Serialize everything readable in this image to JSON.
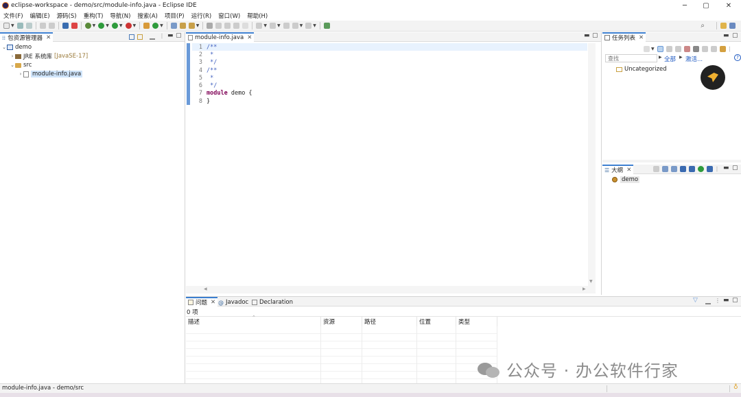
{
  "window": {
    "title": "eclipse-workspace - demo/src/module-info.java - Eclipse IDE",
    "minimize": "─",
    "maximize": "▢",
    "close": "✕"
  },
  "menu": [
    "文件(F)",
    "编辑(E)",
    "源码(S)",
    "重构(T)",
    "导航(N)",
    "搜索(A)",
    "项目(P)",
    "运行(R)",
    "窗口(W)",
    "帮助(H)"
  ],
  "package_explorer": {
    "tab_label": "包资源管理器",
    "tree": [
      {
        "twisty": "⌄",
        "label": "demo",
        "icon": "project-icon"
      },
      {
        "twisty": "›",
        "label": "JRE 系统库",
        "extra": "[JavaSE-17]",
        "icon": "library-icon"
      },
      {
        "twisty": "⌄",
        "label": "src",
        "icon": "package-folder-icon"
      },
      {
        "twisty": "›",
        "label": "module-info.java",
        "icon": "java-file-icon",
        "selected": true
      }
    ]
  },
  "editor": {
    "tab_label": "module-info.java",
    "lines": [
      {
        "n": "1",
        "parts": [
          {
            "c": "cmt",
            "t": "/**"
          }
        ]
      },
      {
        "n": "2",
        "parts": [
          {
            "c": "cmt",
            "t": " *"
          }
        ]
      },
      {
        "n": "3",
        "parts": [
          {
            "c": "cmt",
            "t": " */"
          }
        ]
      },
      {
        "n": "4",
        "parts": [
          {
            "c": "cmt",
            "t": "/**"
          }
        ]
      },
      {
        "n": "5",
        "parts": [
          {
            "c": "cmt",
            "t": " *"
          }
        ]
      },
      {
        "n": "6",
        "parts": [
          {
            "c": "cmt",
            "t": " */"
          }
        ]
      },
      {
        "n": "7",
        "parts": [
          {
            "c": "kw",
            "t": "module"
          },
          {
            "c": "",
            "t": " demo {"
          }
        ]
      },
      {
        "n": "8",
        "parts": [
          {
            "c": "",
            "t": "}"
          }
        ]
      }
    ]
  },
  "task_list": {
    "tab_label": "任务列表",
    "search_placeholder": "查找",
    "all_link": "全部",
    "activate_link": "激活...",
    "help": "?",
    "category": "Uncategorized"
  },
  "outline": {
    "tab_label": "大纲",
    "item": "demo"
  },
  "bottom": {
    "tabs": [
      {
        "label": "问题",
        "active": true
      },
      {
        "label": "Javadoc",
        "active": false
      },
      {
        "label": "Declaration",
        "active": false
      }
    ],
    "count": "0 项",
    "columns": [
      "描述",
      "资源",
      "路径",
      "位置",
      "类型"
    ]
  },
  "watermark": "公众号 · 办公软件行家",
  "status": {
    "text": "module-info.java - demo/src"
  },
  "colors": {
    "accent": "#3c7fd0",
    "keyword": "#7f0055",
    "comment": "#3f5fbf",
    "selection": "#cfe4fa"
  }
}
